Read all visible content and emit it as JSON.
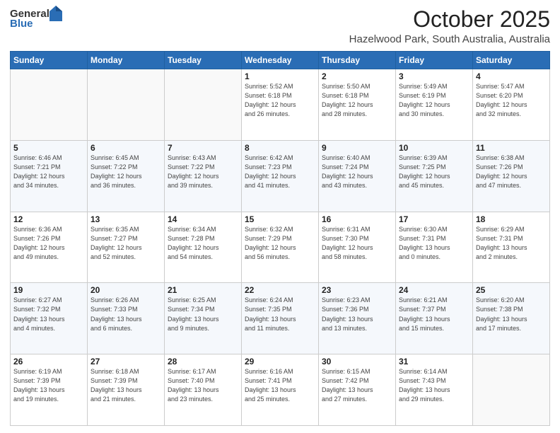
{
  "logo": {
    "general": "General",
    "blue": "Blue"
  },
  "header": {
    "month": "October 2025",
    "location": "Hazelwood Park, South Australia, Australia"
  },
  "weekdays": [
    "Sunday",
    "Monday",
    "Tuesday",
    "Wednesday",
    "Thursday",
    "Friday",
    "Saturday"
  ],
  "weeks": [
    [
      {
        "day": "",
        "info": ""
      },
      {
        "day": "",
        "info": ""
      },
      {
        "day": "",
        "info": ""
      },
      {
        "day": "1",
        "info": "Sunrise: 5:52 AM\nSunset: 6:18 PM\nDaylight: 12 hours\nand 26 minutes."
      },
      {
        "day": "2",
        "info": "Sunrise: 5:50 AM\nSunset: 6:18 PM\nDaylight: 12 hours\nand 28 minutes."
      },
      {
        "day": "3",
        "info": "Sunrise: 5:49 AM\nSunset: 6:19 PM\nDaylight: 12 hours\nand 30 minutes."
      },
      {
        "day": "4",
        "info": "Sunrise: 5:47 AM\nSunset: 6:20 PM\nDaylight: 12 hours\nand 32 minutes."
      }
    ],
    [
      {
        "day": "5",
        "info": "Sunrise: 6:46 AM\nSunset: 7:21 PM\nDaylight: 12 hours\nand 34 minutes."
      },
      {
        "day": "6",
        "info": "Sunrise: 6:45 AM\nSunset: 7:22 PM\nDaylight: 12 hours\nand 36 minutes."
      },
      {
        "day": "7",
        "info": "Sunrise: 6:43 AM\nSunset: 7:22 PM\nDaylight: 12 hours\nand 39 minutes."
      },
      {
        "day": "8",
        "info": "Sunrise: 6:42 AM\nSunset: 7:23 PM\nDaylight: 12 hours\nand 41 minutes."
      },
      {
        "day": "9",
        "info": "Sunrise: 6:40 AM\nSunset: 7:24 PM\nDaylight: 12 hours\nand 43 minutes."
      },
      {
        "day": "10",
        "info": "Sunrise: 6:39 AM\nSunset: 7:25 PM\nDaylight: 12 hours\nand 45 minutes."
      },
      {
        "day": "11",
        "info": "Sunrise: 6:38 AM\nSunset: 7:26 PM\nDaylight: 12 hours\nand 47 minutes."
      }
    ],
    [
      {
        "day": "12",
        "info": "Sunrise: 6:36 AM\nSunset: 7:26 PM\nDaylight: 12 hours\nand 49 minutes."
      },
      {
        "day": "13",
        "info": "Sunrise: 6:35 AM\nSunset: 7:27 PM\nDaylight: 12 hours\nand 52 minutes."
      },
      {
        "day": "14",
        "info": "Sunrise: 6:34 AM\nSunset: 7:28 PM\nDaylight: 12 hours\nand 54 minutes."
      },
      {
        "day": "15",
        "info": "Sunrise: 6:32 AM\nSunset: 7:29 PM\nDaylight: 12 hours\nand 56 minutes."
      },
      {
        "day": "16",
        "info": "Sunrise: 6:31 AM\nSunset: 7:30 PM\nDaylight: 12 hours\nand 58 minutes."
      },
      {
        "day": "17",
        "info": "Sunrise: 6:30 AM\nSunset: 7:31 PM\nDaylight: 13 hours\nand 0 minutes."
      },
      {
        "day": "18",
        "info": "Sunrise: 6:29 AM\nSunset: 7:31 PM\nDaylight: 13 hours\nand 2 minutes."
      }
    ],
    [
      {
        "day": "19",
        "info": "Sunrise: 6:27 AM\nSunset: 7:32 PM\nDaylight: 13 hours\nand 4 minutes."
      },
      {
        "day": "20",
        "info": "Sunrise: 6:26 AM\nSunset: 7:33 PM\nDaylight: 13 hours\nand 6 minutes."
      },
      {
        "day": "21",
        "info": "Sunrise: 6:25 AM\nSunset: 7:34 PM\nDaylight: 13 hours\nand 9 minutes."
      },
      {
        "day": "22",
        "info": "Sunrise: 6:24 AM\nSunset: 7:35 PM\nDaylight: 13 hours\nand 11 minutes."
      },
      {
        "day": "23",
        "info": "Sunrise: 6:23 AM\nSunset: 7:36 PM\nDaylight: 13 hours\nand 13 minutes."
      },
      {
        "day": "24",
        "info": "Sunrise: 6:21 AM\nSunset: 7:37 PM\nDaylight: 13 hours\nand 15 minutes."
      },
      {
        "day": "25",
        "info": "Sunrise: 6:20 AM\nSunset: 7:38 PM\nDaylight: 13 hours\nand 17 minutes."
      }
    ],
    [
      {
        "day": "26",
        "info": "Sunrise: 6:19 AM\nSunset: 7:39 PM\nDaylight: 13 hours\nand 19 minutes."
      },
      {
        "day": "27",
        "info": "Sunrise: 6:18 AM\nSunset: 7:39 PM\nDaylight: 13 hours\nand 21 minutes."
      },
      {
        "day": "28",
        "info": "Sunrise: 6:17 AM\nSunset: 7:40 PM\nDaylight: 13 hours\nand 23 minutes."
      },
      {
        "day": "29",
        "info": "Sunrise: 6:16 AM\nSunset: 7:41 PM\nDaylight: 13 hours\nand 25 minutes."
      },
      {
        "day": "30",
        "info": "Sunrise: 6:15 AM\nSunset: 7:42 PM\nDaylight: 13 hours\nand 27 minutes."
      },
      {
        "day": "31",
        "info": "Sunrise: 6:14 AM\nSunset: 7:43 PM\nDaylight: 13 hours\nand 29 minutes."
      },
      {
        "day": "",
        "info": ""
      }
    ]
  ]
}
